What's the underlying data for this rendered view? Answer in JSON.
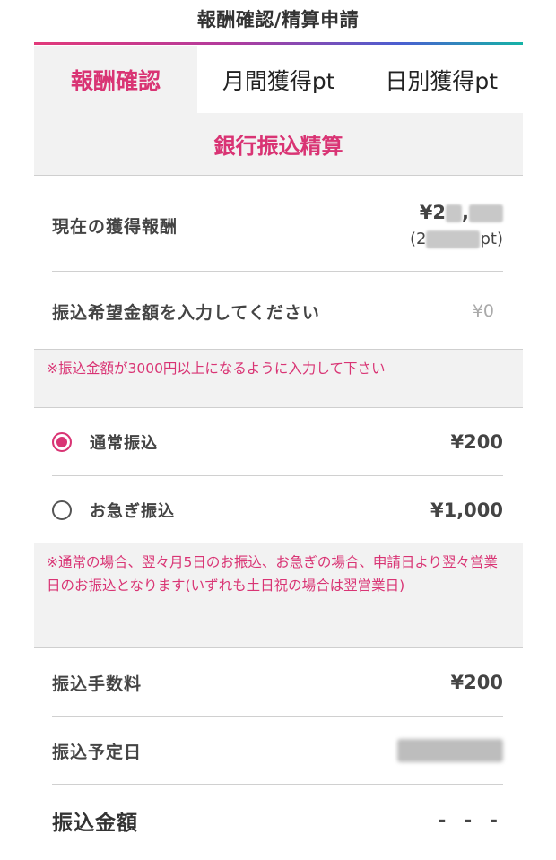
{
  "header": {
    "title": "報酬確認/精算申請"
  },
  "tabs": [
    {
      "label": "報酬確認",
      "active": true
    },
    {
      "label": "月間獲得pt",
      "active": false
    },
    {
      "label": "日別獲得pt",
      "active": false
    }
  ],
  "section": {
    "title": "銀行振込精算"
  },
  "reward": {
    "label": "現在の獲得報酬",
    "amount_prefix": "¥2",
    "amount_sep": ",",
    "pt_prefix": "(2",
    "pt_suffix": "pt)"
  },
  "transfer_input": {
    "label": "振込希望金額を入力してください",
    "placeholder": "¥0"
  },
  "notice_min": "※振込金額が3000円以上になるように入力して下さい",
  "options": [
    {
      "label": "通常振込",
      "fee": "¥200",
      "selected": true
    },
    {
      "label": "お急ぎ振込",
      "fee": "¥1,000",
      "selected": false
    }
  ],
  "notice_schedule": "※通常の場合、翌々月5日のお振込、お急ぎの場合、申請日より翌々営業日のお振込となります(いずれも土日祝の場合は翌営業日)",
  "fee": {
    "label": "振込手数料",
    "value": "¥200"
  },
  "scheduled_date": {
    "label": "振込予定日"
  },
  "total": {
    "label": "振込金額",
    "value": "- - -"
  },
  "colors": {
    "accent": "#d93474",
    "section_bg": "#f2f2f2"
  }
}
